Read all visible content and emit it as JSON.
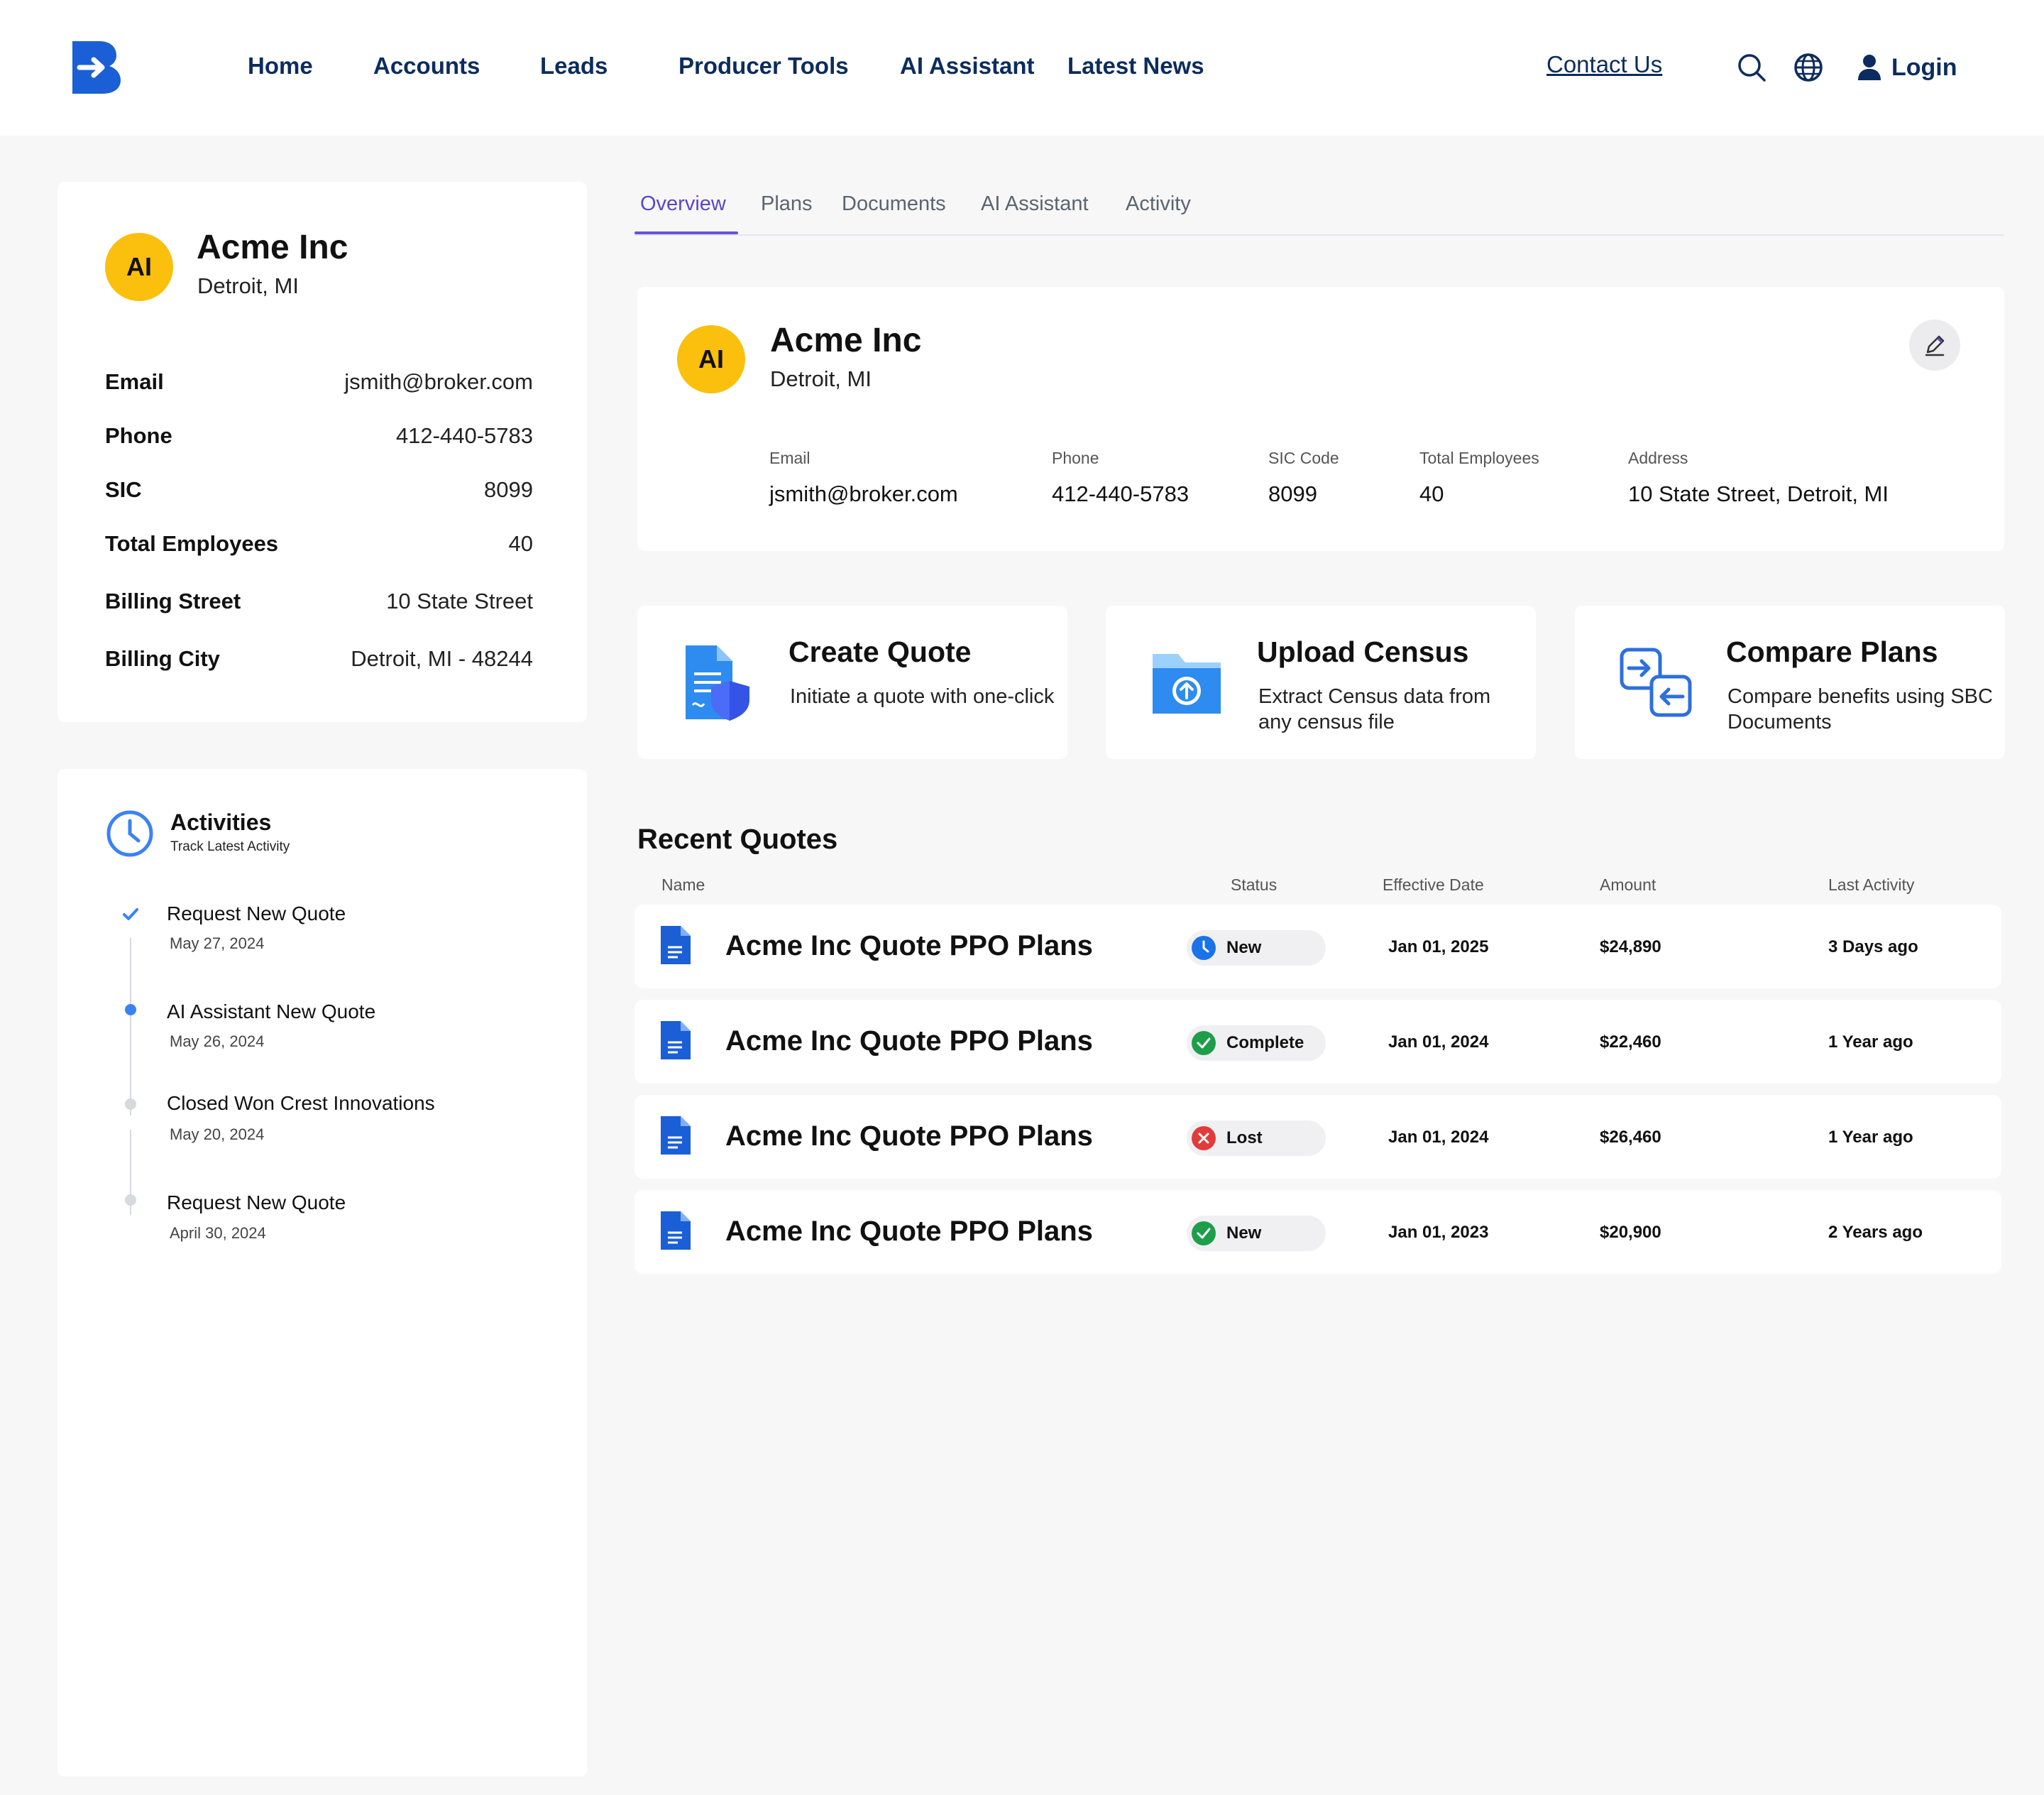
{
  "header": {
    "nav": [
      "Home",
      "Accounts",
      "Leads",
      "Producer Tools",
      "AI Assistant",
      "Latest News"
    ],
    "contact": "Contact Us",
    "login": "Login"
  },
  "account": {
    "initials": "AI",
    "name": "Acme Inc",
    "location": "Detroit, MI",
    "details": [
      {
        "label": "Email",
        "value": "jsmith@broker.com"
      },
      {
        "label": "Phone",
        "value": "412-440-5783"
      },
      {
        "label": "SIC",
        "value": "8099"
      },
      {
        "label": "Total Employees",
        "value": "40"
      },
      {
        "label": "Billing Street",
        "value": "10 State Street"
      },
      {
        "label": "Billing City",
        "value": "Detroit, MI - 48244"
      }
    ]
  },
  "activities": {
    "title": "Activities",
    "subtitle": "Track Latest Activity",
    "items": [
      {
        "title": "Request New Quote",
        "date": "May 27, 2024"
      },
      {
        "title": "AI Assistant New Quote",
        "date": "May 26, 2024"
      },
      {
        "title": "Closed Won Crest Innovations",
        "date": "May 20, 2024"
      },
      {
        "title": "Request New Quote",
        "date": "April 30, 2024"
      }
    ]
  },
  "tabs": [
    "Overview",
    "Plans",
    "Documents",
    "AI Assistant",
    "Activity"
  ],
  "profile": {
    "initials": "AI",
    "name": "Acme Inc",
    "location": "Detroit, MI",
    "fields": [
      {
        "label": "Email",
        "value": "jsmith@broker.com"
      },
      {
        "label": "Phone",
        "value": "412-440-5783"
      },
      {
        "label": "SIC Code",
        "value": "8099"
      },
      {
        "label": "Total Employees",
        "value": "40"
      },
      {
        "label": "Address",
        "value": "10 State Street, Detroit, MI"
      }
    ]
  },
  "actions": [
    {
      "title": "Create Quote",
      "desc": "Initiate a quote with one-click",
      "icon": "quote-shield-icon"
    },
    {
      "title": "Upload Census",
      "desc": "Extract Census data from any census file",
      "icon": "upload-folder-icon"
    },
    {
      "title": "Compare Plans",
      "desc": "Compare benefits using SBC Documents",
      "icon": "compare-arrows-icon"
    }
  ],
  "recent_quotes": {
    "title": "Recent Quotes",
    "columns": [
      "Name",
      "Status",
      "Effective Date",
      "Amount",
      "Last Activity"
    ],
    "rows": [
      {
        "name": "Acme Inc Quote PPO Plans",
        "status": "New",
        "status_icon": "clock-icon",
        "date": "Jan 01, 2025",
        "amount": "$24,890",
        "last": "3 Days ago"
      },
      {
        "name": "Acme Inc Quote PPO Plans",
        "status": "Complete",
        "status_icon": "check-icon",
        "date": "Jan 01, 2024",
        "amount": "$22,460",
        "last": "1 Year ago"
      },
      {
        "name": "Acme Inc Quote PPO Plans",
        "status": "Lost",
        "status_icon": "x-icon",
        "date": "Jan 01, 2024",
        "amount": "$26,460",
        "last": "1 Year ago"
      },
      {
        "name": "Acme Inc Quote PPO Plans",
        "status": "New",
        "status_icon": "check-icon",
        "date": "Jan 01, 2023",
        "amount": "$20,900",
        "last": "2 Years ago"
      }
    ]
  },
  "colors": {
    "brand": "#1a5fd6",
    "navy": "#0c2c5e",
    "avatar": "#fbbf0e",
    "tab_active": "#5b45c9",
    "status_new": "#1a73e8",
    "status_complete": "#1e9e4a",
    "status_lost": "#e23b3b"
  }
}
